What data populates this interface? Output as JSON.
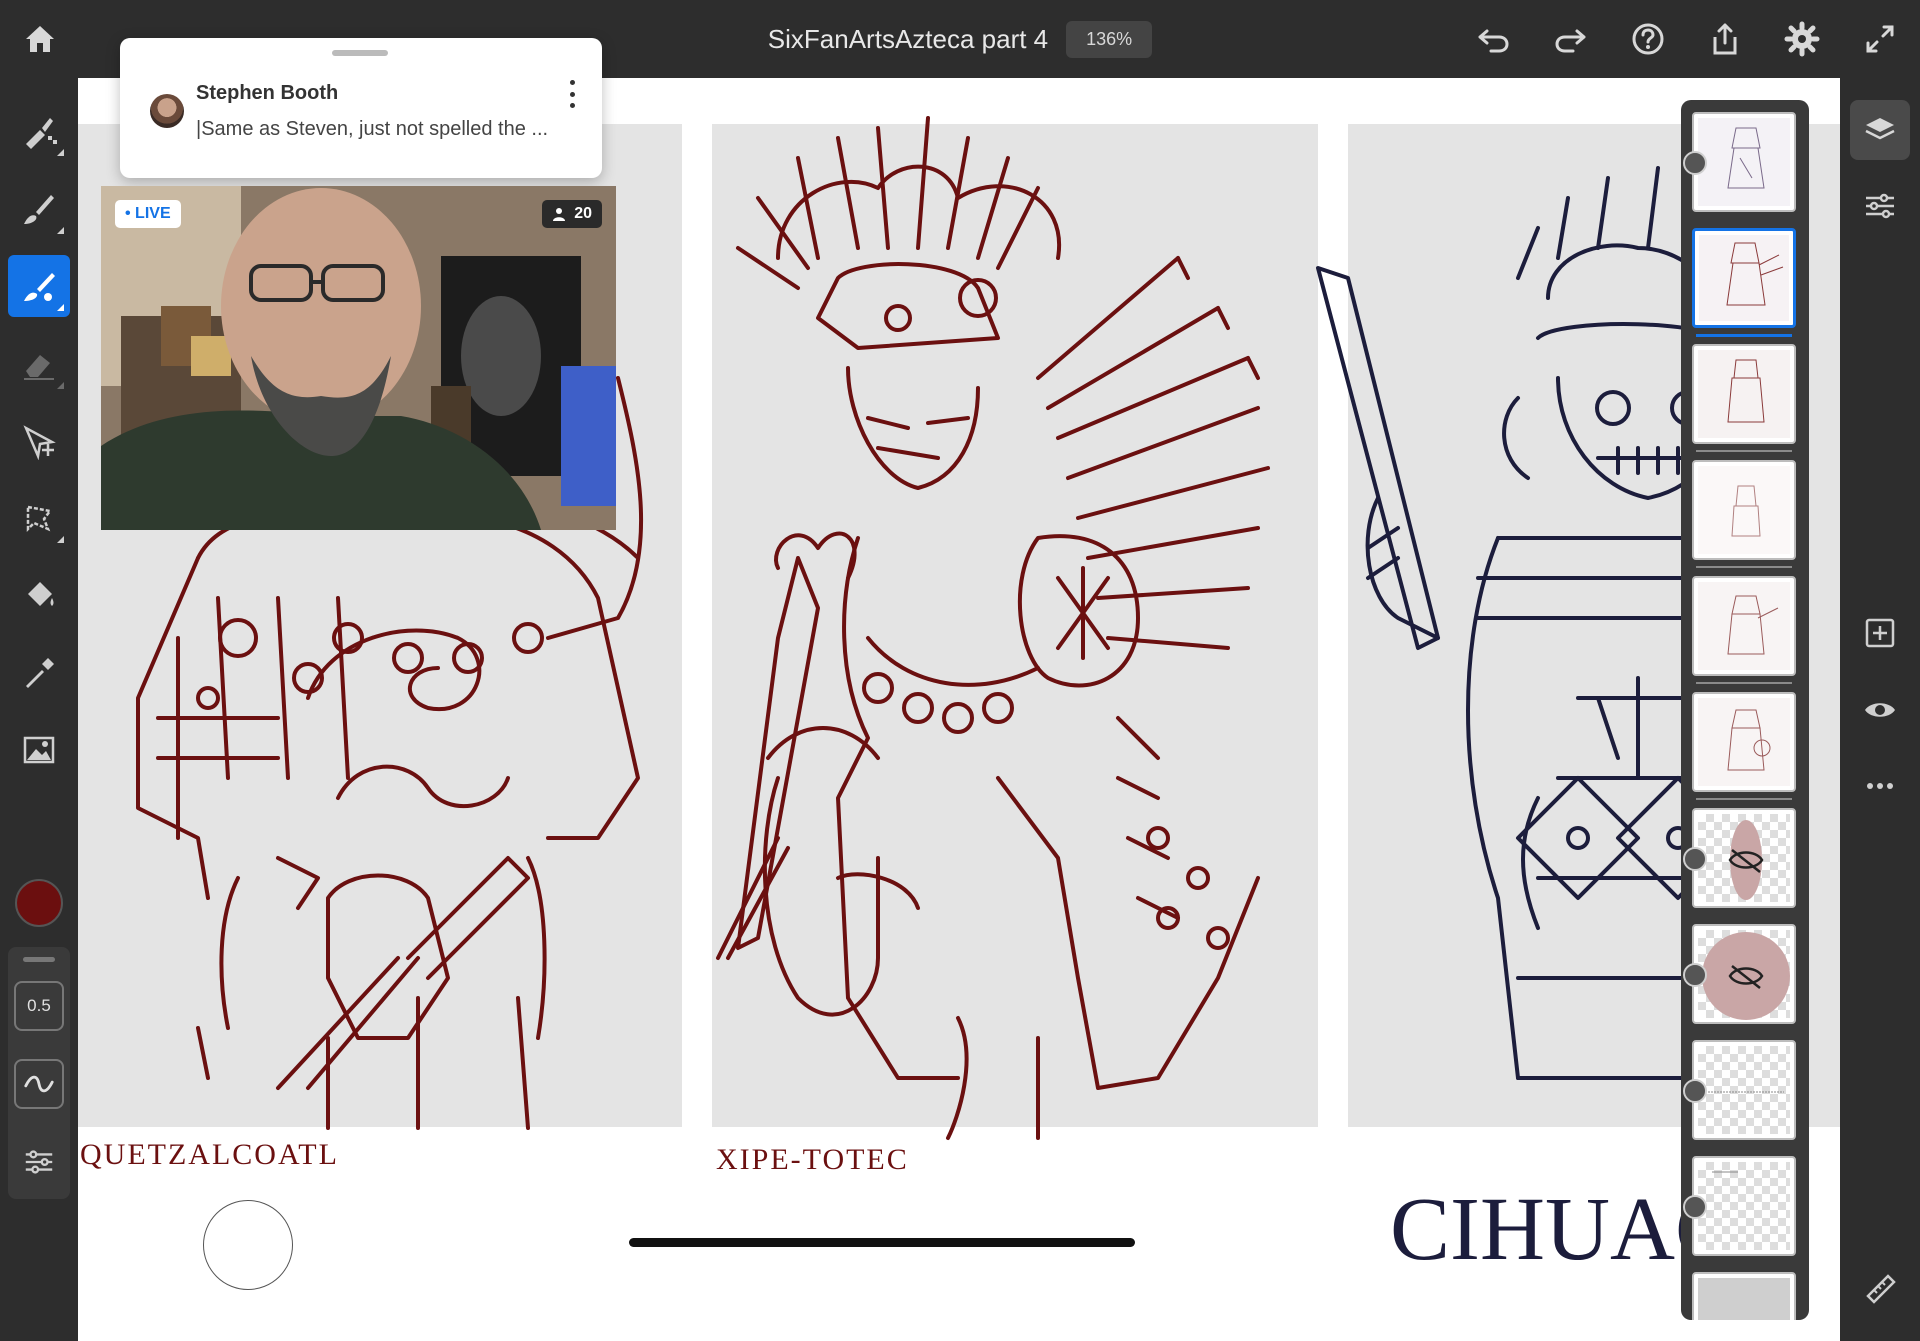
{
  "document": {
    "title": "SixFanArtsAzteca part 4",
    "zoom": "136%"
  },
  "top_toolbar": {
    "icons": [
      "home-icon",
      "undo-icon",
      "redo-icon",
      "help-icon",
      "share-icon",
      "settings-icon",
      "fullscreen-icon"
    ]
  },
  "left_toolbar": {
    "tools": [
      "pixel-brush-icon",
      "live-brush-icon",
      "vector-brush-icon",
      "eraser-icon",
      "transform-icon",
      "lasso-icon",
      "fill-icon",
      "eyedropper-icon",
      "image-icon"
    ],
    "active_tool": "vector-brush-icon",
    "color": "#6b0f0f",
    "brush_size": "0.5"
  },
  "chat": {
    "author": "Stephen Booth",
    "message": "|Same as Steven, just not spelled the ..."
  },
  "livestream": {
    "live_label": "• LIVE",
    "viewer_count": "20"
  },
  "canvas": {
    "labels": [
      "QUETZALCOATL",
      "XIPE-TOTEC",
      "CIHUACO"
    ],
    "line_color_maroon": "#6b1010",
    "line_color_navy": "#1c1d3c"
  },
  "right_toolbar": {
    "icons": [
      "layers-icon",
      "layer-properties-icon",
      "add-layer-icon",
      "visibility-icon",
      "more-icon",
      "ruler-icon"
    ]
  },
  "layers_panel": {
    "layer_count": 11,
    "selected_index": 1,
    "hidden_layers": [
      6,
      7
    ]
  }
}
